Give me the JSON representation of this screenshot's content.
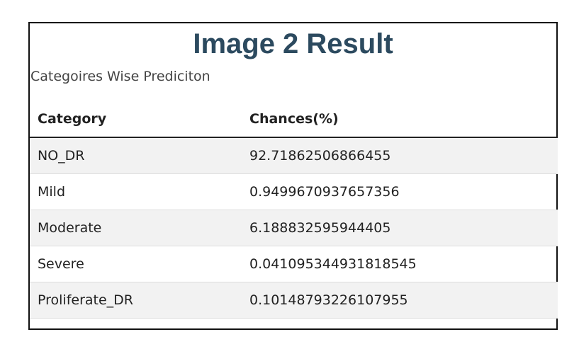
{
  "result": {
    "title": "Image 2 Result",
    "subtitle": "Categoires Wise Prediciton",
    "table": {
      "headers": [
        "Category",
        "Chances(%)"
      ],
      "rows": [
        {
          "category": "NO_DR",
          "chance": "92.71862506866455"
        },
        {
          "category": "Mild",
          "chance": "0.9499670937657356"
        },
        {
          "category": "Moderate",
          "chance": "6.188832595944405"
        },
        {
          "category": "Severe",
          "chance": "0.041095344931818545"
        },
        {
          "category": "Proliferate_DR",
          "chance": "0.10148793226107955"
        }
      ]
    }
  },
  "colors": {
    "title": "#2c4a5f",
    "stripe": "#f2f2f2",
    "border": "#111111"
  }
}
